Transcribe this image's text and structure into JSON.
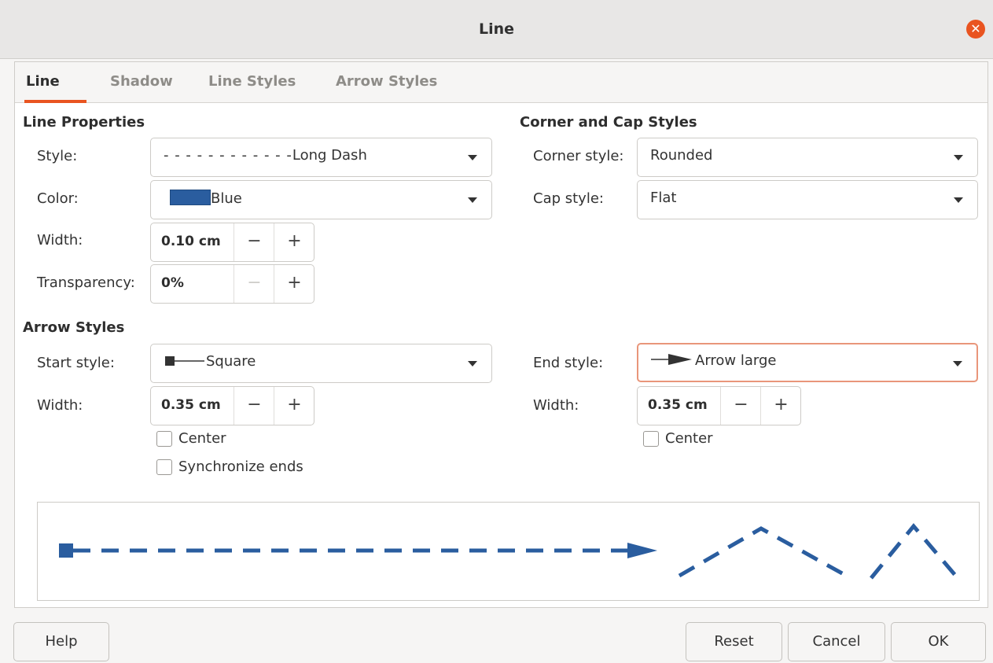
{
  "window": {
    "title": "Line"
  },
  "tabs": [
    "Line",
    "Shadow",
    "Line Styles",
    "Arrow Styles"
  ],
  "line_properties": {
    "heading": "Line Properties",
    "style_label": "Style:",
    "style_value": "Long Dash",
    "color_label": "Color:",
    "color_value": "Blue",
    "color_swatch": "#2a5d9f",
    "width_label": "Width:",
    "width_value": "0.10 cm",
    "transparency_label": "Transparency:",
    "transparency_value": "0%"
  },
  "corner_cap": {
    "heading": "Corner and Cap Styles",
    "corner_label": "Corner style:",
    "corner_value": "Rounded",
    "cap_label": "Cap style:",
    "cap_value": "Flat"
  },
  "arrow_styles": {
    "heading": "Arrow Styles",
    "start_label": "Start style:",
    "start_value": "Square",
    "start_width_label": "Width:",
    "start_width_value": "0.35 cm",
    "center_label": "Center",
    "sync_label": "Synchronize ends",
    "end_label": "End style:",
    "end_value": "Arrow large",
    "end_width_label": "Width:",
    "end_width_value": "0.35 cm",
    "end_center_label": "Center"
  },
  "spin": {
    "minus": "−",
    "plus": "+"
  },
  "buttons": {
    "help": "Help",
    "reset": "Reset",
    "cancel": "Cancel",
    "ok": "OK"
  },
  "colors": {
    "accent": "#e95420",
    "line": "#2a5d9f"
  }
}
